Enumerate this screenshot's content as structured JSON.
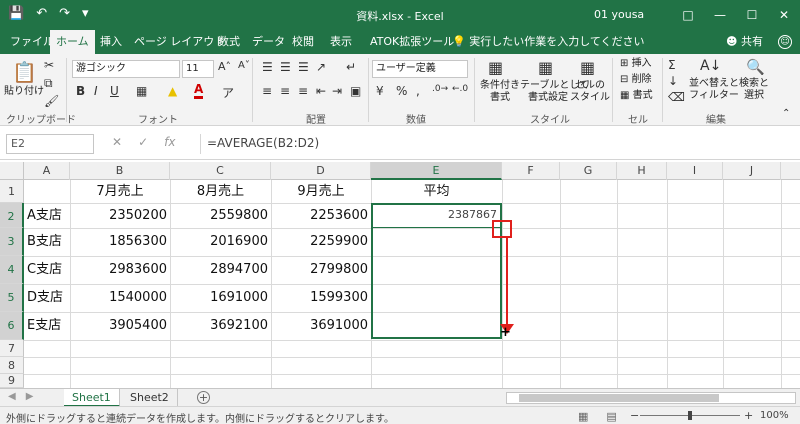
{
  "window": {
    "title": "資料.xlsx  -  Excel",
    "user": "01 yousa",
    "qat_icons": [
      "save-icon",
      "undo-icon",
      "redo-icon",
      "customize-icon"
    ]
  },
  "ribbon_tabs": [
    "ファイル",
    "ホーム",
    "挿入",
    "ページ レイアウト",
    "数式",
    "データ",
    "校閲",
    "表示",
    "ATOK拡張ツール"
  ],
  "tell_me": "実行したい作業を入力してください",
  "share": "共有",
  "ribbon": {
    "paste": "貼り付け",
    "clipboard_label": "クリップボード",
    "font_name": "游ゴシック",
    "font_size": "11",
    "font_label": "フォント",
    "bold": "B",
    "italic": "I",
    "underline": "U",
    "font_color_letter": "A",
    "align_label": "配置",
    "number_format": "ユーザー定義",
    "number_label": "数値",
    "cond_format": "条件付き\n書式",
    "table_format": "テーブルとして\n書式設定",
    "cell_style": "セルの\nスタイル",
    "style_label": "スタイル",
    "insert": "挿入",
    "delete": "削除",
    "format": "書式",
    "cells_label": "セル",
    "sort_filter": "並べ替えと\nフィルター",
    "find_select": "検索と\n選択",
    "edit_label": "編集"
  },
  "formula_bar": {
    "name_box": "E2",
    "formula": "=AVERAGE(B2:D2)"
  },
  "columns": [
    "A",
    "B",
    "C",
    "D",
    "E",
    "F",
    "G",
    "H",
    "I",
    "J"
  ],
  "rows": [
    "1",
    "2",
    "3",
    "4",
    "5",
    "6",
    "7",
    "8",
    "9"
  ],
  "table": {
    "headers": [
      "",
      "7月売上",
      "8月売上",
      "9月売上",
      "平均"
    ],
    "data": [
      [
        "A支店",
        "2350200",
        "2559800",
        "2253600",
        "2387867"
      ],
      [
        "B支店",
        "1856300",
        "2016900",
        "2259900",
        ""
      ],
      [
        "C支店",
        "2983600",
        "2894700",
        "2799800",
        ""
      ],
      [
        "D支店",
        "1540000",
        "1691000",
        "1599300",
        ""
      ],
      [
        "E支店",
        "3905400",
        "3692100",
        "3691000",
        ""
      ]
    ]
  },
  "sheets": [
    "Sheet1",
    "Sheet2"
  ],
  "status": {
    "message": "外側にドラッグすると連続データを作成します。内側にドラッグするとクリアします。",
    "zoom": "100%"
  }
}
